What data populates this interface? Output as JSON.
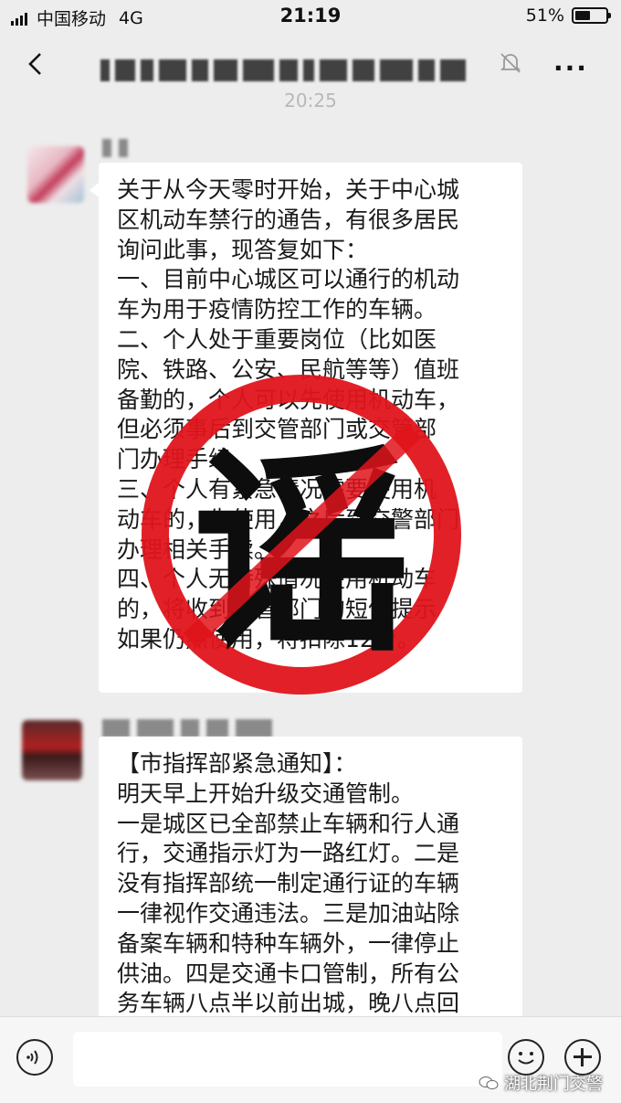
{
  "status_bar": {
    "carrier": "中国移动",
    "network": "4G",
    "time": "21:19",
    "battery": "51%",
    "battery_level": 0.51
  },
  "chat": {
    "timestamp": "20:25",
    "messages": [
      {
        "lines": [
          "关于从今天零时开始，关于中心城",
          "区机动车禁行的通告，有很多居民",
          "询问此事，现答复如下：",
          "一、目前中心城区可以通行的机动",
          "车为用于疫情防控工作的车辆。",
          "二、个人处于重要岗位（比如医",
          "院、铁路、公安、民航等等）值班",
          "备勤的，个人可以先使用机动车，",
          "但必须事后到交管部门或交管部",
          "门办理手续。",
          "三、个人有紧急情况需要使用机",
          "动车的，先使用，之后到交警部门",
          "办理相关手续。",
          "四、个人无特殊情况使用机动车",
          "的，将收到交管部门的短信提示",
          "如果仍然使用，将扣除12分。"
        ],
        "stamp": "谣"
      },
      {
        "lines": [
          "【市指挥部紧急通知】：",
          "明天早上开始升级交通管制。",
          "一是城区已全部禁止车辆和行人通",
          "行，交通指示灯为一路红灯。二是",
          "没有指挥部统一制定通行证的车辆",
          "一律视作交通违法。三是加油站除",
          "备案车辆和特种车辆外，一律停止",
          "供油。四是交通卡口管制，所有公",
          "务车辆八点半以前出城，晚八点回"
        ]
      }
    ]
  },
  "watermark": "湖北荆门交警",
  "colors": {
    "background": "#ededed",
    "bubble": "#ffffff",
    "stamp_red": "#e0141b",
    "stamp_glyph": "#0d0d0d"
  },
  "icons": [
    "back-arrow-icon",
    "mute-bell-icon",
    "more-icon",
    "voice-icon",
    "emoji-icon",
    "plus-icon",
    "wechat-icon"
  ]
}
